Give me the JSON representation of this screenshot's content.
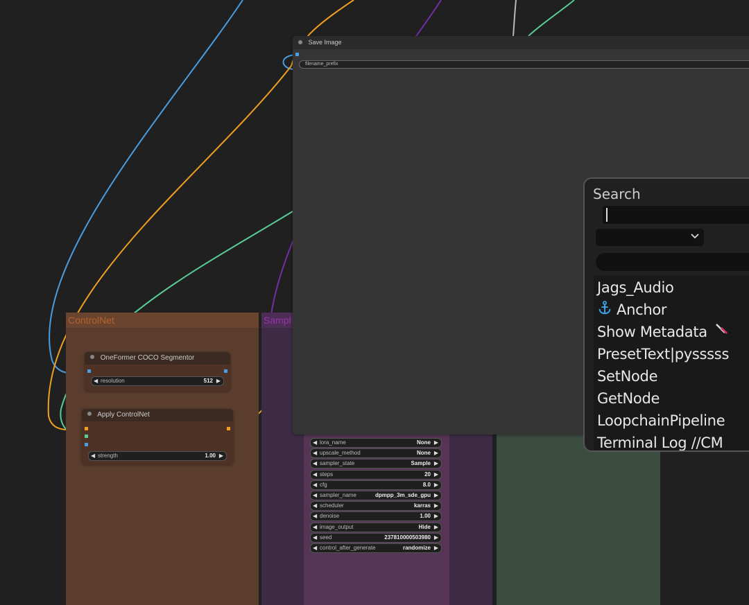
{
  "groups": {
    "controlnet_title": "ControlNet",
    "sampler_title": "Sampl"
  },
  "nodes": {
    "oneformer": {
      "title": "OneFormer COCO Segmentor",
      "widgets": [
        {
          "label": "resolution",
          "value": "512"
        }
      ]
    },
    "apply_controlnet": {
      "title": "Apply ControlNet",
      "widgets": [
        {
          "label": "strength",
          "value": "1.00"
        }
      ]
    },
    "sampler": {
      "widgets": [
        {
          "label": "lora_name",
          "value": "None"
        },
        {
          "label": "upscale_method",
          "value": "None"
        },
        {
          "label": "sampler_state",
          "value": "Sample"
        },
        {
          "label": "steps",
          "value": "20"
        },
        {
          "label": "cfg",
          "value": "8.0"
        },
        {
          "label": "sampler_name",
          "value": "dpmpp_3m_sde_gpu"
        },
        {
          "label": "scheduler",
          "value": "karras"
        },
        {
          "label": "denoise",
          "value": "1.00"
        },
        {
          "label": "image_output",
          "value": "Hide"
        },
        {
          "label": "seed",
          "value": "237810000503980"
        },
        {
          "label": "control_after_generate",
          "value": "randomize"
        }
      ]
    },
    "save_image": {
      "title": "Save Image",
      "widget_label": "filename_prefix"
    }
  },
  "search": {
    "title": "Search",
    "query": "",
    "results": [
      {
        "label": "Jags_Audio",
        "icon": ""
      },
      {
        "label": "Anchor",
        "icon": "anchor-icon"
      },
      {
        "label": "Show Metadata",
        "icon": "pipette-icon"
      },
      {
        "label": "PresetText|pysssss",
        "icon": ""
      },
      {
        "label": "SetNode",
        "icon": ""
      },
      {
        "label": "GetNode",
        "icon": ""
      },
      {
        "label": "LoopchainPipeline",
        "icon": ""
      },
      {
        "label": "Terminal Log //CM",
        "icon": ""
      }
    ]
  },
  "colors": {
    "wire_blue": "#4a9de0",
    "wire_orange": "#f0a020",
    "wire_green": "#5acc95",
    "wire_purple": "#7030a8",
    "wire_gray": "#a0b0a0"
  }
}
